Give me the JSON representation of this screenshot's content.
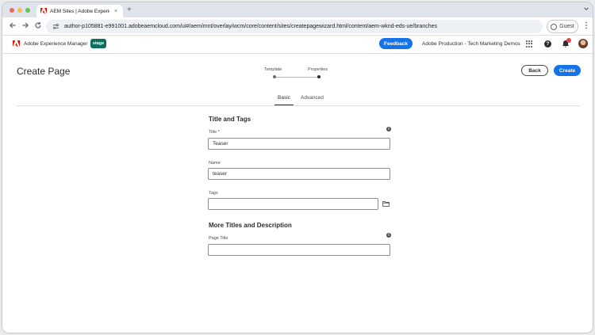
{
  "browser": {
    "tab_title": "AEM Sites | Adobe Experience",
    "tab_close": "×",
    "new_tab": "+",
    "url": "author-p105881-e991001.adobeaemcloud.com/ui#/aem/mnt/overlay/wcm/core/content/sites/createpagewizard.html/content/aem-wknd-eds-ue/branches",
    "guest_label": "Guest",
    "icons": {
      "back": "arrow-left-icon",
      "forward": "arrow-right-icon",
      "reload": "reload-icon",
      "site_info": "tune-icon",
      "menu": "kebab-menu-icon"
    }
  },
  "header": {
    "product_name": "Adobe Experience Manager",
    "env_badge": "stage",
    "feedback_label": "Feedback",
    "org_name": "Adobe Production - Tech Marketing Demos",
    "help_glyph": "?",
    "colors": {
      "accent": "#1473e6",
      "badge": "#0d6e60",
      "notification": "#e34850"
    }
  },
  "page": {
    "title": "Create Page",
    "steps": [
      {
        "label": "Template"
      },
      {
        "label": "Properties"
      }
    ],
    "back_label": "Back",
    "create_label": "Create",
    "tabs": [
      {
        "label": "Basic",
        "selected": true
      },
      {
        "label": "Advanced",
        "selected": false
      }
    ]
  },
  "form": {
    "section_title_tags": "Title and Tags",
    "title_label": "Title *",
    "title_value": "Teaser",
    "name_label": "Name",
    "name_value": "teaser",
    "tags_label": "Tags",
    "tags_value": "",
    "section_more": "More Titles and Description",
    "page_title_label": "Page Title",
    "page_title_value": "",
    "info_glyph": "i"
  }
}
